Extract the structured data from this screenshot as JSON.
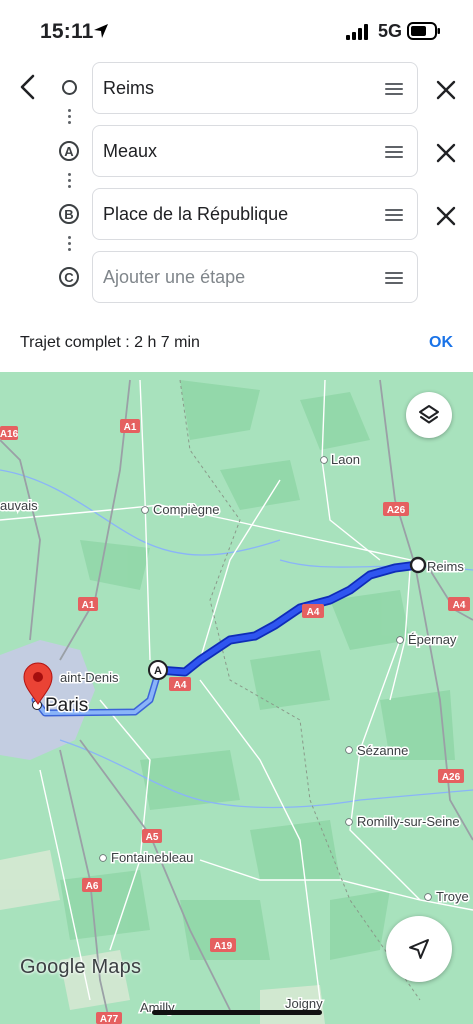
{
  "status": {
    "time": "15:11",
    "network": "5G"
  },
  "route": {
    "stops": [
      {
        "marker": "",
        "value": "Reims",
        "placeholder": ""
      },
      {
        "marker": "A",
        "value": "Meaux",
        "placeholder": ""
      },
      {
        "marker": "B",
        "value": "Place de la République",
        "placeholder": ""
      },
      {
        "marker": "C",
        "value": "",
        "placeholder": "Ajouter une étape"
      }
    ],
    "summary": "Trajet complet : 2 h 7 min",
    "ok_label": "OK"
  },
  "map": {
    "cities": {
      "laon": "Laon",
      "compiegne": "Compiègne",
      "beauvais": "auvais",
      "reims": "Reims",
      "epernay": "Épernay",
      "saint_denis": "aint-Denis",
      "paris": "Paris",
      "sezanne": "Sézanne",
      "romilly": "Romilly-sur-Seine",
      "fontainebleau": "Fontainebleau",
      "troyes": "Troye",
      "amilly": "Amilly",
      "joigny": "Joigny"
    },
    "roads": {
      "a16": "A16",
      "a1_top": "A1",
      "a26_top": "A26",
      "a1_mid": "A1",
      "a4_mid": "A4",
      "a4_right": "A4",
      "a4_paris": "A4",
      "a26_bottom": "A26",
      "a5": "A5",
      "a6": "A6",
      "a19": "A19",
      "a77": "A77"
    },
    "waypoint_label": "A",
    "attribution": "Google Maps",
    "colors": {
      "route_primary": "#1a3fe0",
      "route_alternate": "#8ab4f8",
      "road_shield": "#e56060",
      "land": "#a8e2bd"
    }
  }
}
